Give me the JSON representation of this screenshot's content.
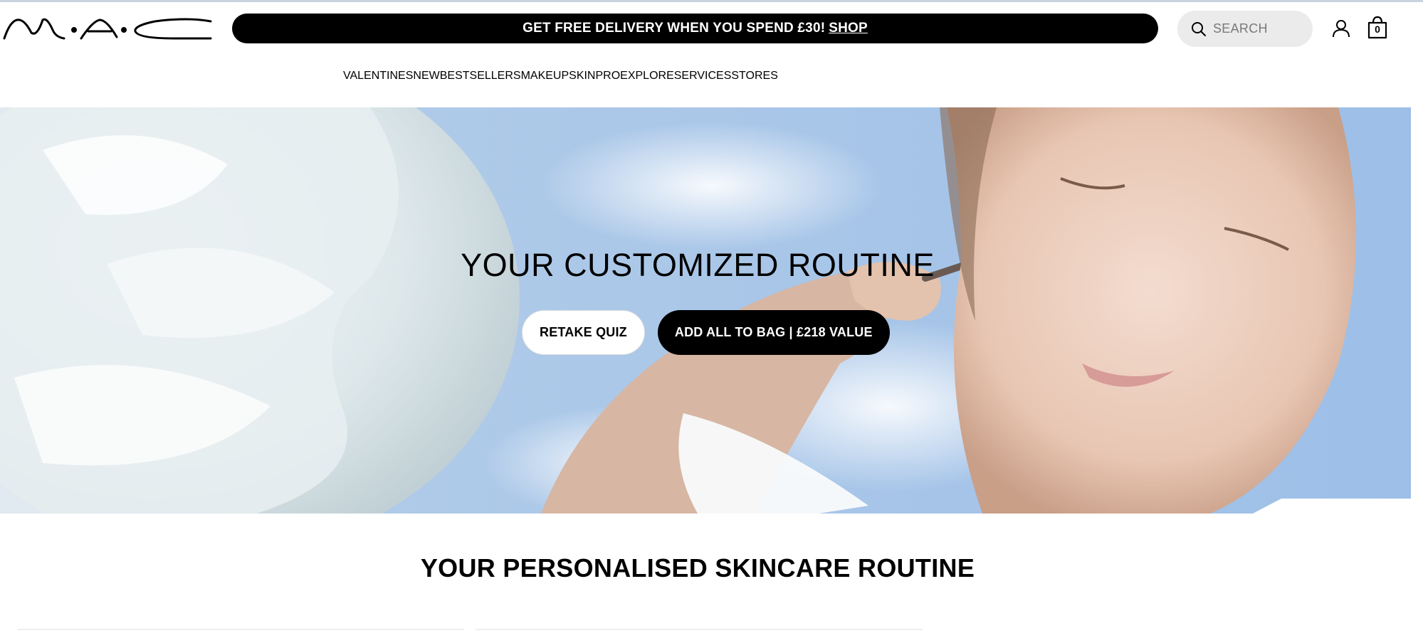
{
  "header": {
    "logo_text": "M·A·C",
    "promo_text": "GET FREE DELIVERY WHEN YOU SPEND £30!",
    "promo_link": "SHOP",
    "search_placeholder": "SEARCH",
    "bag_count": "0"
  },
  "nav": {
    "items": [
      {
        "label": "VALENTINES",
        "active": true
      },
      {
        "label": "NEW"
      },
      {
        "label": "BESTSELLERS"
      },
      {
        "label": "MAKEUP"
      },
      {
        "label": "SKIN"
      },
      {
        "label": "PRO"
      },
      {
        "label": "EXPLORE"
      },
      {
        "label": "SERVICES"
      },
      {
        "label": "STORES"
      }
    ],
    "active_color": "#e8278a"
  },
  "hero": {
    "title": "YOUR CUSTOMIZED ROUTINE",
    "retake_label": "RETAKE QUIZ",
    "add_label": "ADD ALL TO BAG | £218 VALUE"
  },
  "section": {
    "title": "YOUR PERSONALISED SKINCARE ROUTINE"
  },
  "colors": {
    "sky": "#a9c8ea",
    "accent": "#e8278a"
  }
}
